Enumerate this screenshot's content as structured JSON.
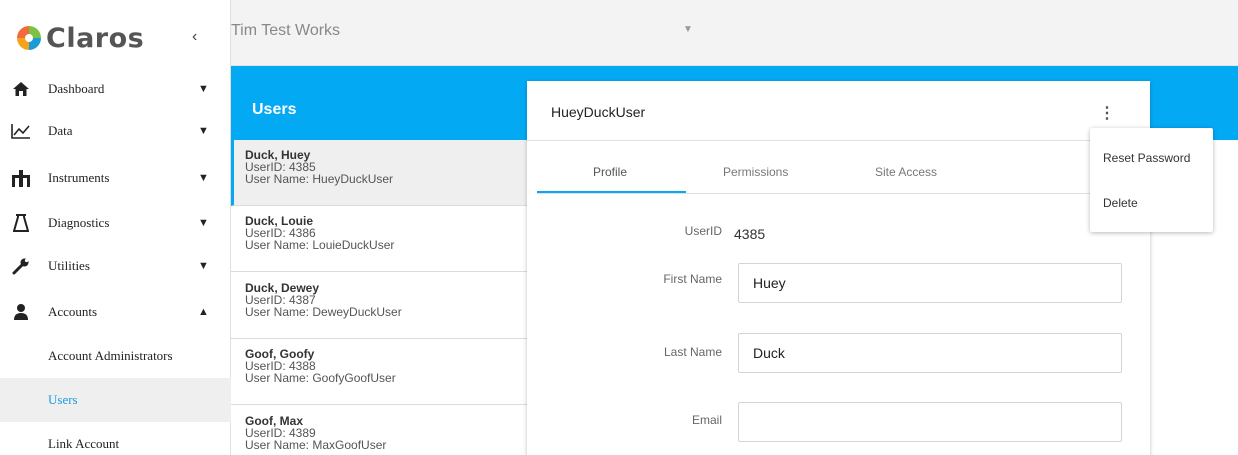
{
  "brand": {
    "name": "Claros"
  },
  "topbar": {
    "organization": "Tim Test Works"
  },
  "sidebar": {
    "items": [
      {
        "label": "Dashboard",
        "icon": "home-icon"
      },
      {
        "label": "Data",
        "icon": "line-chart-icon"
      },
      {
        "label": "Instruments",
        "icon": "instrument-icon"
      },
      {
        "label": "Diagnostics",
        "icon": "flask-icon"
      },
      {
        "label": "Utilities",
        "icon": "wrench-icon"
      },
      {
        "label": "Accounts",
        "icon": "person-icon"
      }
    ],
    "subitems": [
      {
        "label": "Account Administrators"
      },
      {
        "label": "Users",
        "active": true
      },
      {
        "label": "Link Account"
      }
    ]
  },
  "section": {
    "title": "Users"
  },
  "users": [
    {
      "name": "Duck, Huey",
      "userid": "UserID: 4385",
      "username": "User Name: HueyDuckUser"
    },
    {
      "name": "Duck, Louie",
      "userid": "UserID: 4386",
      "username": "User Name: LouieDuckUser"
    },
    {
      "name": "Duck, Dewey",
      "userid": "UserID: 4387",
      "username": "User Name: DeweyDuckUser"
    },
    {
      "name": "Goof, Goofy",
      "userid": "UserID: 4388",
      "username": "User Name: GoofyGoofUser"
    },
    {
      "name": "Goof, Max",
      "userid": "UserID: 4389",
      "username": "User Name: MaxGoofUser"
    }
  ],
  "detail": {
    "title": "HueyDuckUser",
    "tabs": [
      "Profile",
      "Permissions",
      "Site Access"
    ],
    "fields": {
      "userid_label": "UserID",
      "userid_value": "4385",
      "first_name_label": "First Name",
      "first_name_value": "Huey",
      "last_name_label": "Last Name",
      "last_name_value": "Duck",
      "email_label": "Email",
      "email_value": ""
    }
  },
  "menu": {
    "items": [
      "Reset Password",
      "Delete"
    ]
  },
  "colors": {
    "accent": "#04a9f4",
    "logo_green": "#7cc242",
    "logo_orange": "#f7a21b",
    "logo_blue": "#1c9ad6"
  }
}
